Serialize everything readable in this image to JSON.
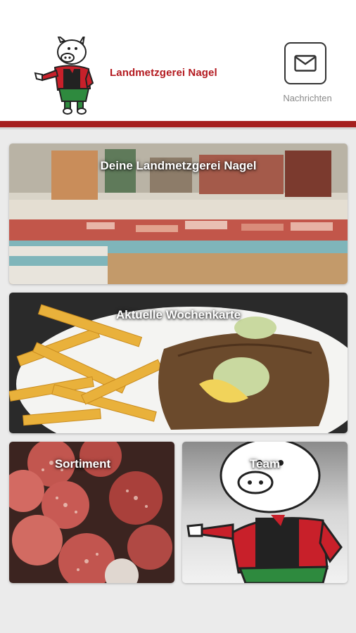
{
  "header": {
    "brand_name": "Landmetzgerei Nagel",
    "messages_label": "Nachrichten",
    "accent_color": "#a51f1f"
  },
  "tiles": [
    {
      "title": "Deine Landmetzgerei Nagel",
      "image": "butcher-shop-counter"
    },
    {
      "title": "Aktuelle Wochenkarte",
      "image": "schnitzel-with-fries"
    },
    {
      "title": "Sortiment",
      "image": "sausage-salami-slices"
    },
    {
      "title": "Team",
      "image": "pig-mascot"
    }
  ],
  "icons": {
    "logo": "pig-mascot-logo",
    "messages": "envelope-icon"
  }
}
